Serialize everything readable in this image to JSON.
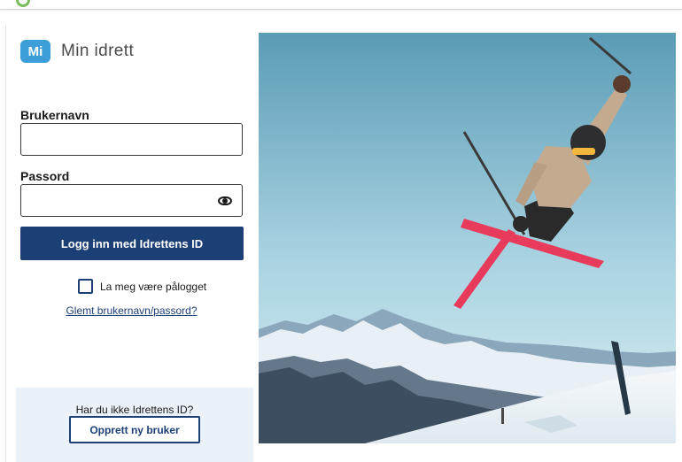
{
  "brand": {
    "badge": "Mi",
    "name": "Min idrett"
  },
  "form": {
    "username_label": "Brukernavn",
    "username_value": "",
    "password_label": "Passord",
    "password_value": "",
    "login_button": "Logg inn med Idrettens ID",
    "remember_label": "La meg være pålogget",
    "remember_checked": false,
    "forgot_link": "Glemt brukernavn/passord?"
  },
  "register": {
    "question": "Har du ikke Idrettens ID?",
    "button": "Opprett ny bruker"
  },
  "icons": {
    "password_toggle": "eye-icon"
  },
  "colors": {
    "primary": "#1c3f75",
    "brand_badge": "#3e9fd8",
    "register_bg": "#eaf1f9",
    "sky_top": "#5f9fb9",
    "ski_red": "#e83a5b"
  }
}
